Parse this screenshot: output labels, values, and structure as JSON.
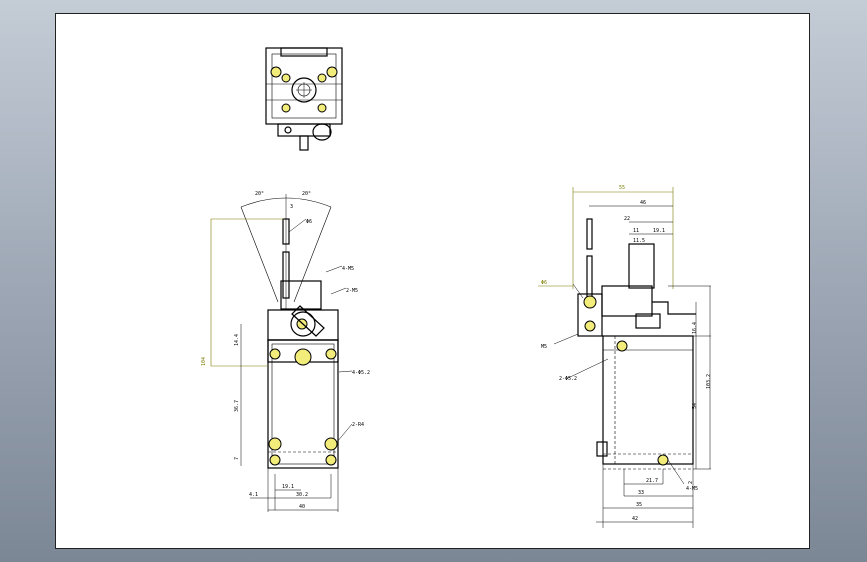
{
  "colors": {
    "background_top": "#c4ccd6",
    "background_bottom": "#7c8796",
    "sheet": "#ffffff",
    "line": "#000000",
    "dimension_highlight": "#7a7a00",
    "hole_fill": "#f2ec7a"
  },
  "front_view": {
    "angle_left": "20°",
    "angle_right": "20°",
    "dim_top": "3",
    "dim_rod": "Φ6",
    "dim_4m5": "4-M5",
    "dim_2m5": "2-M5",
    "dim_4phi52": "4-Φ5.2",
    "dim_2r4": "2-R4",
    "dim_height": "104",
    "dim_14": "14.4",
    "dim_36": "36.7",
    "dim_7": "7",
    "dim_191": "19.1",
    "dim_302": "30.2",
    "dim_41": "4.1",
    "dim_40": "40"
  },
  "side_view": {
    "dim_55": "55",
    "dim_46": "46",
    "dim_22": "22",
    "dim_11": "11",
    "dim_191": "19.1",
    "dim_115": "11.5",
    "dim_phi6": "Φ6",
    "dim_m5": "M5",
    "dim_2phi52": "2-Φ5.2",
    "dim_164": "16.4",
    "dim_54": "54",
    "dim_1032": "103.2",
    "dim_2": "2",
    "dim_4m5": "4-M5",
    "dim_217": "21.7",
    "dim_33": "33",
    "dim_35": "35",
    "dim_42": "42"
  }
}
